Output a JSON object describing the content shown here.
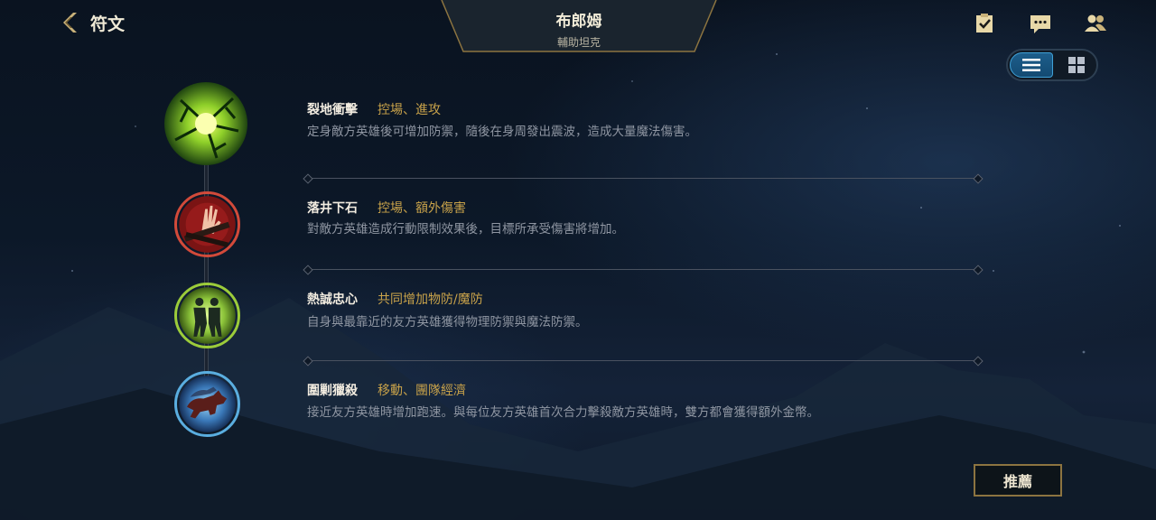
{
  "header": {
    "back_label": "符文",
    "champion_name": "布郎姆",
    "champion_role": "輔助坦克"
  },
  "top_icons": [
    "checklist-icon",
    "chat-icon",
    "friends-icon"
  ],
  "view_toggle": {
    "selected": "list",
    "options": [
      "list",
      "grid"
    ]
  },
  "runes": [
    {
      "name": "裂地衝擊",
      "tags": "控場、進攻",
      "description": "定身敵方英雄後可增加防禦，隨後在身周發出震波，造成大量魔法傷害。",
      "icon": "shockwave-rune-icon"
    },
    {
      "name": "落井下石",
      "tags": "控場、額外傷害",
      "description": "對敵方英雄造成行動限制效果後，目標所承受傷害將增加。",
      "icon": "chained-hand-rune-icon"
    },
    {
      "name": "熱誠忠心",
      "tags": "共同增加物防/魔防",
      "description": "自身與最靠近的友方英雄獲得物理防禦與魔法防禦。",
      "icon": "twin-warriors-rune-icon"
    },
    {
      "name": "圍剿獵殺",
      "tags": "移動、團隊經濟",
      "description": "接近友方英雄時增加跑速。與每位友方英雄首次合力擊殺敵方英雄時，雙方都會獲得額外金幣。",
      "icon": "wolf-pack-rune-icon"
    }
  ],
  "recommend_label": "推薦",
  "colors": {
    "accent_gold": "#c8a24a",
    "toggle_active": "#1d5e8c"
  }
}
